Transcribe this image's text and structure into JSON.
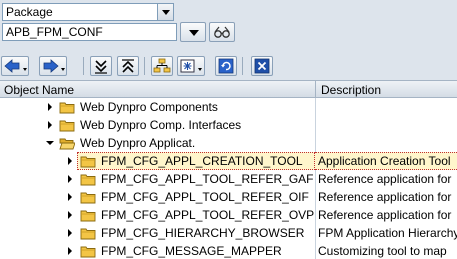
{
  "search": {
    "type_select": "Package",
    "object_input": "APB_FPM_CONF"
  },
  "toolbar": {
    "icons": [
      "back-icon",
      "forward-icon",
      "collapse-icon",
      "expand-icon",
      "hierarchy-icon",
      "display-options-icon",
      "refresh-icon",
      "close-window-icon"
    ]
  },
  "tree": {
    "columns": {
      "object_name": "Object Name",
      "description": "Description"
    },
    "rows": [
      {
        "name": "Web Dynpro Components",
        "desc": ""
      },
      {
        "name": "Web Dynpro Comp. Interfaces",
        "desc": ""
      },
      {
        "name": "Web Dynpro Applicat.",
        "desc": ""
      },
      {
        "name": "FPM_CFG_APPL_CREATION_TOOL",
        "desc": "Application Creation Tool"
      },
      {
        "name": "FPM_CFG_APPL_TOOL_REFER_GAF",
        "desc": "Reference application for"
      },
      {
        "name": "FPM_CFG_APPL_TOOL_REFER_OIF",
        "desc": "Reference application for"
      },
      {
        "name": "FPM_CFG_APPL_TOOL_REFER_OVP",
        "desc": "Reference application for"
      },
      {
        "name": "FPM_CFG_HIERARCHY_BROWSER",
        "desc": "FPM Application Hierarchy"
      },
      {
        "name": "FPM_CFG_MESSAGE_MAPPER",
        "desc": "Customizing tool to map"
      }
    ]
  },
  "colors": {
    "background": "#dde4ec",
    "selection": "#fff6cc",
    "folder": "#f3c545"
  }
}
